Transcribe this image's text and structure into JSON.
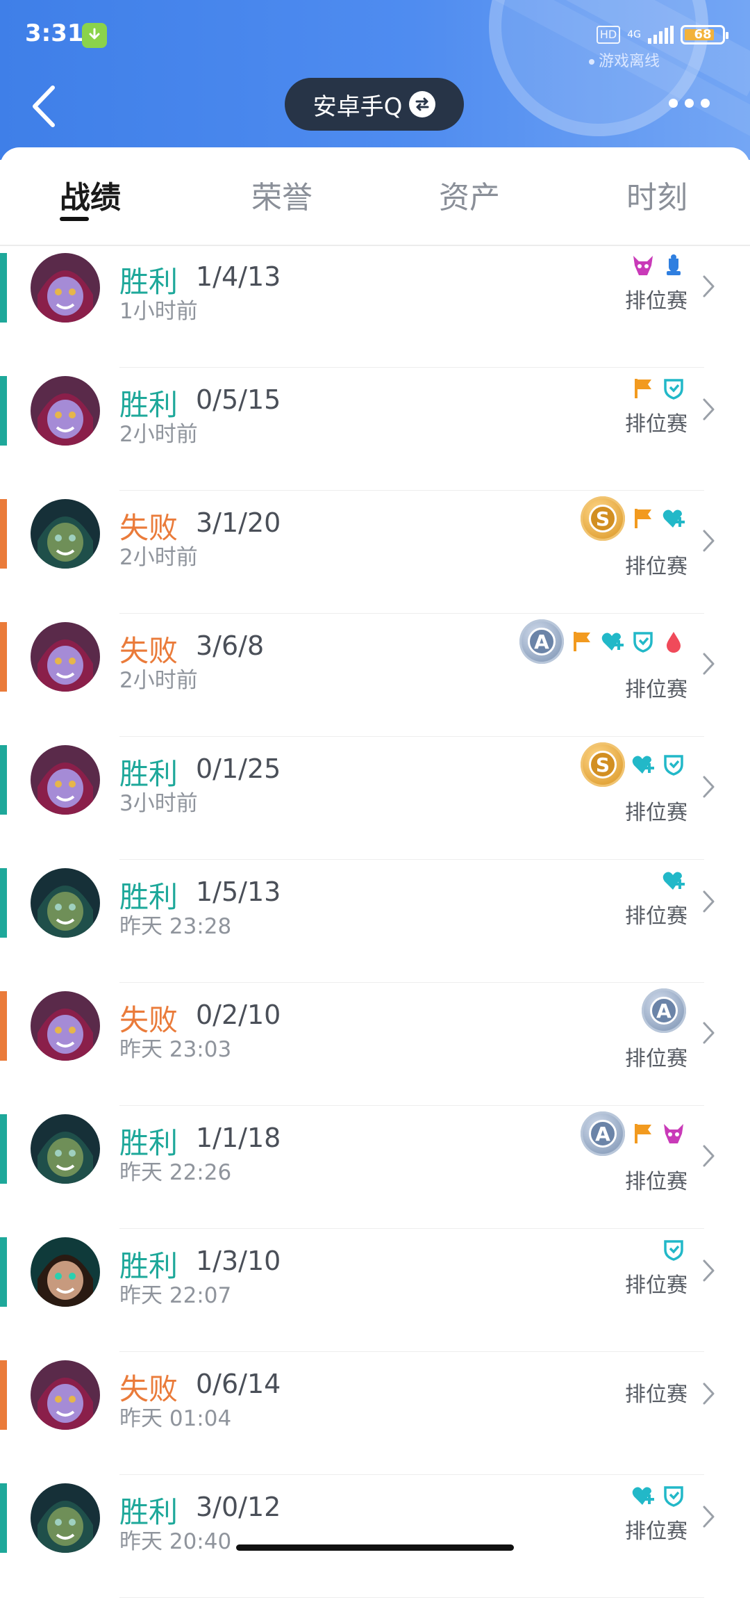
{
  "status_bar": {
    "time": "3:31",
    "hd": "HD",
    "net": "4G",
    "battery": "68",
    "offline_text": "游戏离线"
  },
  "header": {
    "account_label": "安卓手Q"
  },
  "tabs": [
    {
      "label": "战绩"
    },
    {
      "label": "荣誉"
    },
    {
      "label": "资产"
    },
    {
      "label": "时刻"
    }
  ],
  "colors": {
    "win": "#1ea89a",
    "loss": "#ea7b3a",
    "header": "#4f8cf0"
  },
  "matches": [
    {
      "result": "胜利",
      "outcome": "win",
      "kda": "1/4/13",
      "time": "1小时前",
      "mode": "排位赛",
      "hero": "purple",
      "badges": [
        "demon-mask-icon",
        "trophy-icon"
      ]
    },
    {
      "result": "胜利",
      "outcome": "win",
      "kda": "0/5/15",
      "time": "2小时前",
      "mode": "排位赛",
      "hero": "purple",
      "badges": [
        "flag-icon",
        "shield-icon"
      ]
    },
    {
      "result": "失败",
      "outcome": "loss",
      "kda": "3/1/20",
      "time": "2小时前",
      "mode": "排位赛",
      "hero": "green",
      "badges": [
        "s-medal-icon",
        "flag-icon",
        "heart-plus-icon"
      ]
    },
    {
      "result": "失败",
      "outcome": "loss",
      "kda": "3/6/8",
      "time": "2小时前",
      "mode": "排位赛",
      "hero": "purple",
      "badges": [
        "a-medal-icon",
        "flag-icon",
        "heart-plus-icon",
        "shield-icon",
        "blood-drop-icon"
      ]
    },
    {
      "result": "胜利",
      "outcome": "win",
      "kda": "0/1/25",
      "time": "3小时前",
      "mode": "排位赛",
      "hero": "purple",
      "badges": [
        "s-medal-icon",
        "heart-plus-icon",
        "shield-icon"
      ]
    },
    {
      "result": "胜利",
      "outcome": "win",
      "kda": "1/5/13",
      "time": "昨天 23:28",
      "mode": "排位赛",
      "hero": "green",
      "badges": [
        "heart-plus-icon"
      ]
    },
    {
      "result": "失败",
      "outcome": "loss",
      "kda": "0/2/10",
      "time": "昨天 23:03",
      "mode": "排位赛",
      "hero": "purple",
      "badges": [
        "a-medal-icon"
      ]
    },
    {
      "result": "胜利",
      "outcome": "win",
      "kda": "1/1/18",
      "time": "昨天 22:26",
      "mode": "排位赛",
      "hero": "green",
      "badges": [
        "a-medal-icon",
        "flag-icon",
        "demon-mask-icon"
      ]
    },
    {
      "result": "胜利",
      "outcome": "win",
      "kda": "1/3/10",
      "time": "昨天 22:07",
      "mode": "排位赛",
      "hero": "teal",
      "badges": [
        "shield-icon"
      ]
    },
    {
      "result": "失败",
      "outcome": "loss",
      "kda": "0/6/14",
      "time": "昨天 01:04",
      "mode": "排位赛",
      "hero": "purple",
      "badges": []
    },
    {
      "result": "胜利",
      "outcome": "win",
      "kda": "3/0/12",
      "time": "昨天 20:40",
      "mode": "排位赛",
      "hero": "green",
      "badges": [
        "heart-plus-icon",
        "shield-icon"
      ]
    }
  ]
}
